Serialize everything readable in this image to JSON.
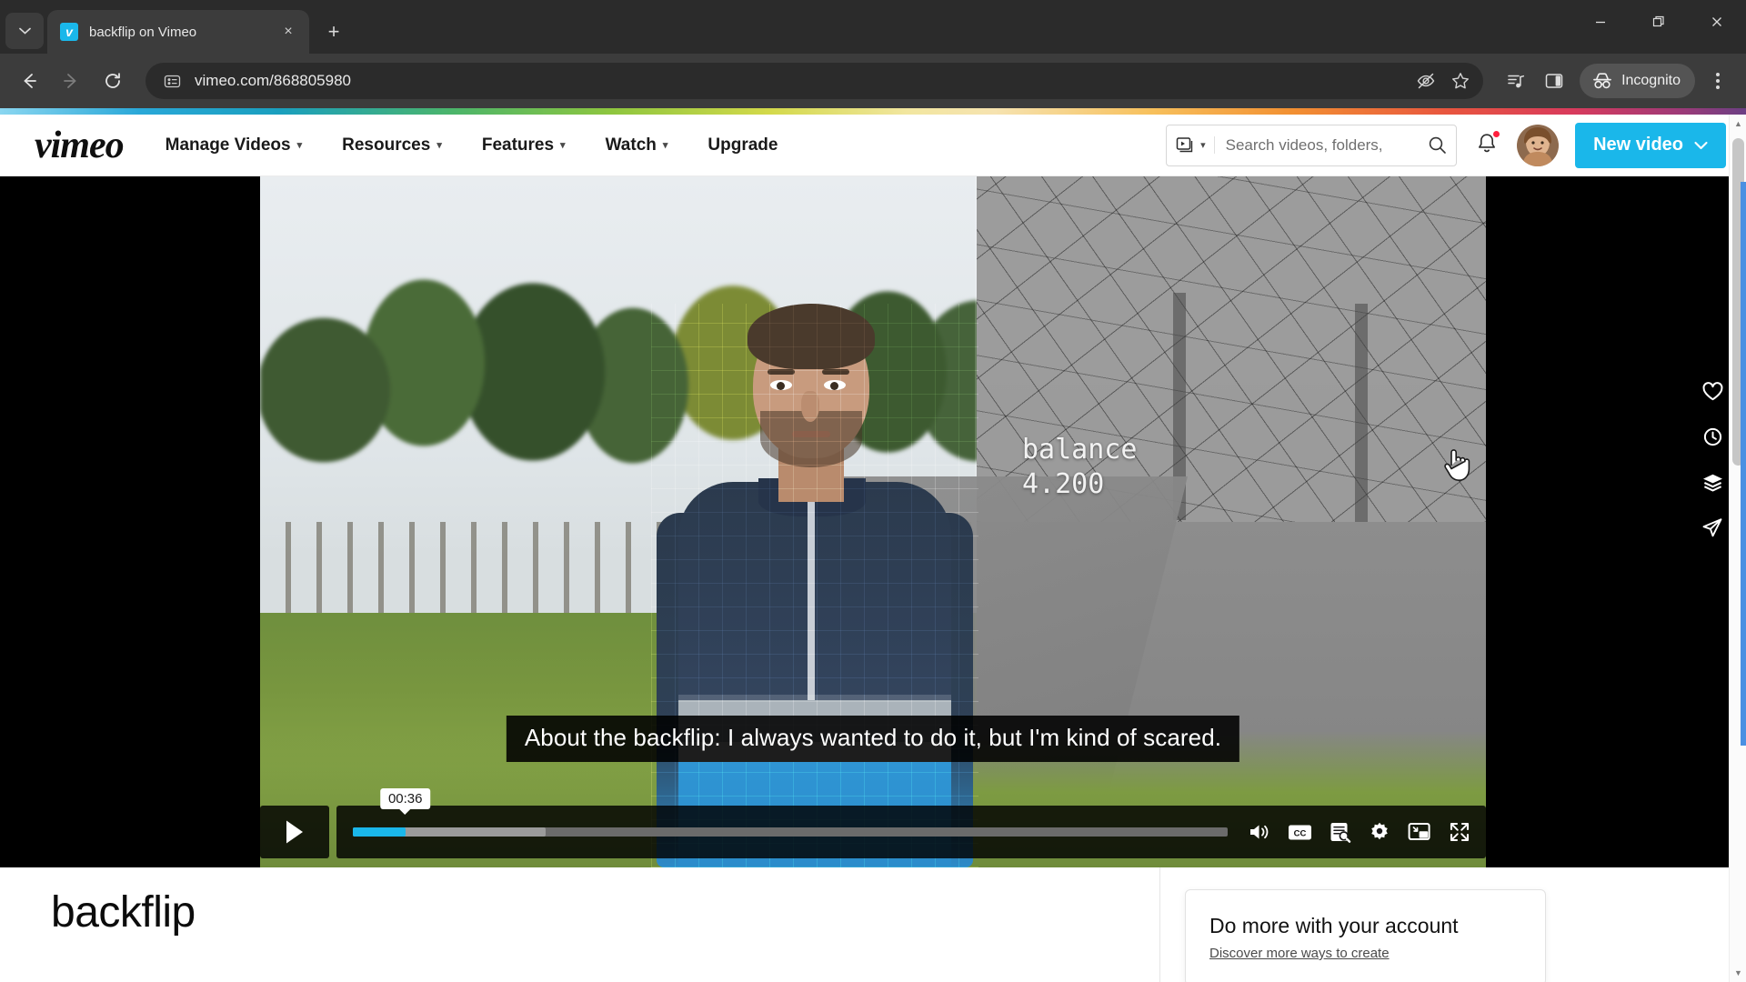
{
  "browser": {
    "tab": {
      "title": "backflip on Vimeo",
      "favicon_letter": "v",
      "favicon_color": "#1ab7ea",
      "close_label": "×"
    },
    "tab_list_icon": "chevron-down-icon",
    "new_tab_label": "+",
    "window_controls": {
      "minimize": "—",
      "maximize": "❐",
      "close": "✕"
    },
    "toolbar": {
      "back_label": "←",
      "forward_label": "→",
      "reload_label": "⟳",
      "site_info_icon": "page-info-icon",
      "url": "vimeo.com/868805980",
      "tracking_icon": "eye-crossed-icon",
      "bookmark_icon": "star-icon",
      "media_icon": "media-playlist-icon",
      "side_panel_icon": "side-panel-icon",
      "incognito_label": "Incognito",
      "menu_icon": "three-dot-menu-icon"
    }
  },
  "vimeo": {
    "logo_text": "vimeo",
    "nav": [
      {
        "label": "Manage Videos",
        "has_chevron": true
      },
      {
        "label": "Resources",
        "has_chevron": true
      },
      {
        "label": "Features",
        "has_chevron": true
      },
      {
        "label": "Watch",
        "has_chevron": true
      },
      {
        "label": "Upgrade",
        "has_chevron": false
      }
    ],
    "search": {
      "type_icon": "video-filter-icon",
      "type_chevron": "chevron-down-icon",
      "placeholder": "Search videos, folders,",
      "value": "",
      "search_icon": "search-icon"
    },
    "notifications": {
      "icon": "bell-icon",
      "has_unread": true
    },
    "avatar_name": "user-avatar",
    "new_video_button": {
      "label": "New video",
      "chevron": "chevron-down-icon",
      "color": "#1ab7ea"
    }
  },
  "player": {
    "overlay_hud": {
      "label": "balance",
      "value": "4.200"
    },
    "caption": "About the backflip: I always wanted to do it, but I'm kind of scared.",
    "actions": [
      {
        "name": "like-button",
        "icon": "heart-icon"
      },
      {
        "name": "watch-later-button",
        "icon": "clock-icon"
      },
      {
        "name": "collections-button",
        "icon": "layers-icon"
      },
      {
        "name": "share-button",
        "icon": "paper-plane-icon"
      }
    ],
    "controls": {
      "play_icon": "play-icon",
      "time_tooltip": "00:36",
      "progress_percent": 6,
      "buffer_percent": 22,
      "accent_color": "#1ab7ea",
      "right_icons": [
        {
          "name": "volume-button",
          "icon": "volume-icon"
        },
        {
          "name": "captions-button",
          "icon": "cc-icon"
        },
        {
          "name": "transcript-button",
          "icon": "transcript-search-icon"
        },
        {
          "name": "settings-button",
          "icon": "gear-icon"
        },
        {
          "name": "pip-button",
          "icon": "picture-in-picture-icon"
        },
        {
          "name": "fullscreen-button",
          "icon": "fullscreen-icon"
        }
      ]
    }
  },
  "below_video": {
    "title": "backflip",
    "account_card": {
      "heading": "Do more with your account",
      "link": "Discover more ways to create"
    }
  },
  "scrollbar": {
    "up_arrow": "▲",
    "down_arrow": "▼"
  }
}
